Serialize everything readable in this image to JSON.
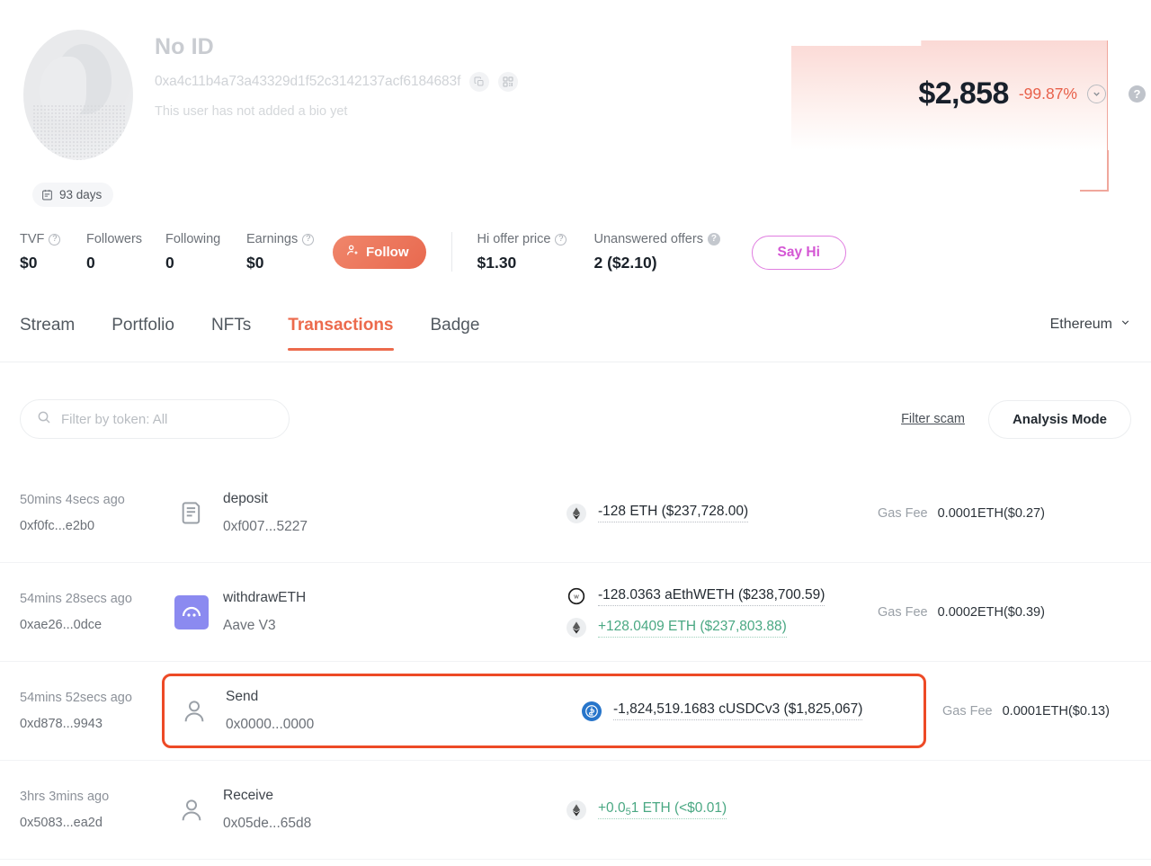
{
  "profile": {
    "display_name": "No ID",
    "address": "0xa4c11b4a73a43329d1f52c3142137acf6184683f",
    "bio": "This user has not added a bio yet",
    "copy_icon": "copy-icon",
    "qr_icon": "qr-code-icon",
    "age_badge": "93 days",
    "age_icon": "calendar-icon",
    "avatar_icon": "default-avatar"
  },
  "balance": {
    "amount": "$2,858",
    "change": "-99.87%",
    "change_color": "#e8604a",
    "expand_icon": "chevron-down-icon",
    "help_icon": "question-mark-icon"
  },
  "stats": [
    {
      "label": "TVF",
      "value": "$0",
      "info": true,
      "info_style": "outline"
    },
    {
      "label": "Followers",
      "value": "0",
      "info": false
    },
    {
      "label": "Following",
      "value": "0",
      "info": false
    },
    {
      "label": "Earnings",
      "value": "$0",
      "info": true,
      "info_style": "outline"
    }
  ],
  "stats_right": [
    {
      "label": "Hi offer price",
      "value": "$1.30",
      "info": true,
      "info_style": "outline"
    },
    {
      "label": "Unanswered offers",
      "value": "2 ($2.10)",
      "info": true,
      "info_style": "solid"
    }
  ],
  "actions": {
    "follow_label": "Follow",
    "follow_icon": "user-plus-icon",
    "follow_color": "#e8694f",
    "sayhi_label": "Say Hi",
    "sayhi_color": "#d456d4"
  },
  "tabs": [
    {
      "label": "Stream",
      "active": false
    },
    {
      "label": "Portfolio",
      "active": false
    },
    {
      "label": "NFTs",
      "active": false
    },
    {
      "label": "Transactions",
      "active": true
    },
    {
      "label": "Badge",
      "active": false
    }
  ],
  "chain_selector": {
    "label": "Ethereum",
    "icon": "chevron-down-icon"
  },
  "toolbar": {
    "search_placeholder": "Filter by token: All",
    "search_value": "",
    "search_icon": "search-icon",
    "filter_scam_label": "Filter scam",
    "analysis_mode_label": "Analysis Mode"
  },
  "transactions": [
    {
      "time_ago": "50mins 4secs ago",
      "tx_hash": "0xf0fc...e2b0",
      "type_icon": "receipt-icon",
      "action": "deposit",
      "counterparty": "0xf007...5227",
      "highlighted": false,
      "amounts": [
        {
          "token_icon": "eth-icon",
          "icon_class": "eth",
          "text": "-128 ETH ($237,728.00)",
          "sign": "neg"
        }
      ],
      "gas_label": "Gas Fee",
      "gas_value": "0.0001ETH($0.27)"
    },
    {
      "time_ago": "54mins 28secs ago",
      "tx_hash": "0xae26...0dce",
      "type_icon": "aave-icon",
      "action": "withdrawETH",
      "counterparty": "Aave V3",
      "highlighted": false,
      "amounts": [
        {
          "token_icon": "aethweth-icon",
          "icon_class": "aweth",
          "text": "-128.0363 aEthWETH ($238,700.59)",
          "sign": "neg"
        },
        {
          "token_icon": "eth-icon",
          "icon_class": "eth",
          "text": "+128.0409 ETH ($237,803.88)",
          "sign": "pos"
        }
      ],
      "gas_label": "Gas Fee",
      "gas_value": "0.0002ETH($0.39)"
    },
    {
      "time_ago": "54mins 52secs ago",
      "tx_hash": "0xd878...9943",
      "type_icon": "person-icon",
      "action": "Send",
      "counterparty": "0x0000...0000",
      "highlighted": true,
      "highlight_color": "#ed4a26",
      "amounts": [
        {
          "token_icon": "cusdcv3-icon",
          "icon_class": "cusdc",
          "text": "-1,824,519.1683 cUSDCv3 ($1,825,067)",
          "sign": "neg"
        }
      ],
      "gas_label": "Gas Fee",
      "gas_value": "0.0001ETH($0.13)"
    },
    {
      "time_ago": "3hrs 3mins ago",
      "tx_hash": "0x5083...ea2d",
      "type_icon": "person-icon",
      "action": "Receive",
      "counterparty": "0x05de...65d8",
      "highlighted": false,
      "amounts": [
        {
          "token_icon": "eth-icon",
          "icon_class": "eth",
          "text_prefix": "+0.0",
          "text_sub": "5",
          "text_suffix": "1 ETH (<$0.01)",
          "text": "+0.0<sub>5</sub>1 ETH (<$0.01)",
          "sign": "pos"
        }
      ],
      "gas_label": "",
      "gas_value": ""
    }
  ]
}
